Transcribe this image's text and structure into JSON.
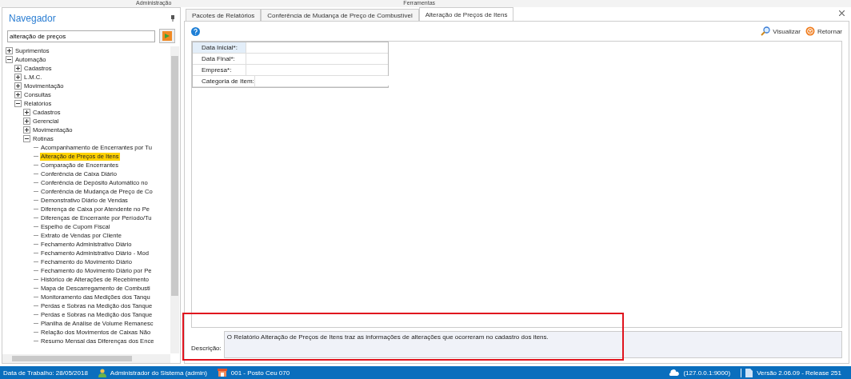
{
  "menu": [
    "Administração",
    "Ferramentas"
  ],
  "navigator": {
    "title": "Navegador",
    "search": {
      "value": "alteração de preços"
    },
    "tree": [
      {
        "label": "Suprimentos",
        "expanded": false
      },
      {
        "label": "Automação",
        "expanded": true,
        "children": [
          {
            "label": "Cadastros",
            "expanded": false
          },
          {
            "label": "L.M.C.",
            "expanded": false
          },
          {
            "label": "Movimentação",
            "expanded": false
          },
          {
            "label": "Consultas",
            "expanded": false
          },
          {
            "label": "Relatórios",
            "expanded": true,
            "children": [
              {
                "label": "Cadastros",
                "expanded": false
              },
              {
                "label": "Gerencial",
                "expanded": false
              },
              {
                "label": "Movimentação",
                "expanded": false
              },
              {
                "label": "Rotinas",
                "expanded": true,
                "children": [
                  {
                    "label": "Acompanhamento de Encerrantes por Tu",
                    "selected": false
                  },
                  {
                    "label": "Alteração de Preços de Itens",
                    "selected": true
                  },
                  {
                    "label": "Comparação de Encerrantes",
                    "selected": false
                  },
                  {
                    "label": "Conferência de Caixa Diário",
                    "selected": false
                  },
                  {
                    "label": "Conferência de Depósito Automático no",
                    "selected": false
                  },
                  {
                    "label": "Conferência de Mudança de Preço de Co",
                    "selected": false
                  },
                  {
                    "label": "Demonstrativo Diário de Vendas",
                    "selected": false
                  },
                  {
                    "label": "Diferença de Caixa por Atendente no Pe",
                    "selected": false
                  },
                  {
                    "label": "Diferenças de Encerrante por Período/Tu",
                    "selected": false
                  },
                  {
                    "label": "Espelho de Cupom Fiscal",
                    "selected": false
                  },
                  {
                    "label": "Extrato de Vendas por Cliente",
                    "selected": false
                  },
                  {
                    "label": "Fechamento Administrativo Diário",
                    "selected": false
                  },
                  {
                    "label": "Fechamento Administrativo Diário - Mod",
                    "selected": false
                  },
                  {
                    "label": "Fechamento do Movimento Diário",
                    "selected": false
                  },
                  {
                    "label": "Fechamento do Movimento Diário por Pe",
                    "selected": false
                  },
                  {
                    "label": "Histórico de Alterações de Recebimento",
                    "selected": false
                  },
                  {
                    "label": "Mapa de Descarregamento de Combusti",
                    "selected": false
                  },
                  {
                    "label": "Monitoramento das Medições dos Tanqu",
                    "selected": false
                  },
                  {
                    "label": "Perdas e Sobras na Medição dos Tanque",
                    "selected": false
                  },
                  {
                    "label": "Perdas e Sobras na Medição dos Tanque",
                    "selected": false
                  },
                  {
                    "label": "Planilha de Análise de Volume Remanesc",
                    "selected": false
                  },
                  {
                    "label": "Relação dos Movimentos de Caixas Não",
                    "selected": false
                  },
                  {
                    "label": "Resumo Mensal das Diferenças dos Ence",
                    "selected": false
                  }
                ]
              }
            ]
          }
        ]
      }
    ]
  },
  "tabs": [
    {
      "label": "Pacotes de Relatórios",
      "selected": false
    },
    {
      "label": "Conferência de Mudança de Preço de Combustível",
      "selected": false
    },
    {
      "label": "Alteração de Preços de Itens",
      "selected": true
    }
  ],
  "toolbar": [
    "Visualizar",
    "Retornar"
  ],
  "fields": [
    {
      "label": "Data Inicial*:",
      "selected": true
    },
    {
      "label": "Data Final*:",
      "selected": false
    },
    {
      "label": "Empresa*:",
      "selected": false
    },
    {
      "label": "Categoria de Item:",
      "selected": false
    }
  ],
  "description": {
    "label": "Descrição:",
    "text": "O Relatório Alteração de Preços de Itens traz as informações de alterações que ocorreram no cadastro dos itens."
  },
  "status_bar": {
    "date": "Data de Trabalho: 28/05/2018",
    "user": "Administrador do Sistema (admin)",
    "store": "001 - Posto Ceu 070",
    "server": "(127.0.0.1:9000)",
    "version": "Versão 2.06.09 - Release 251"
  }
}
